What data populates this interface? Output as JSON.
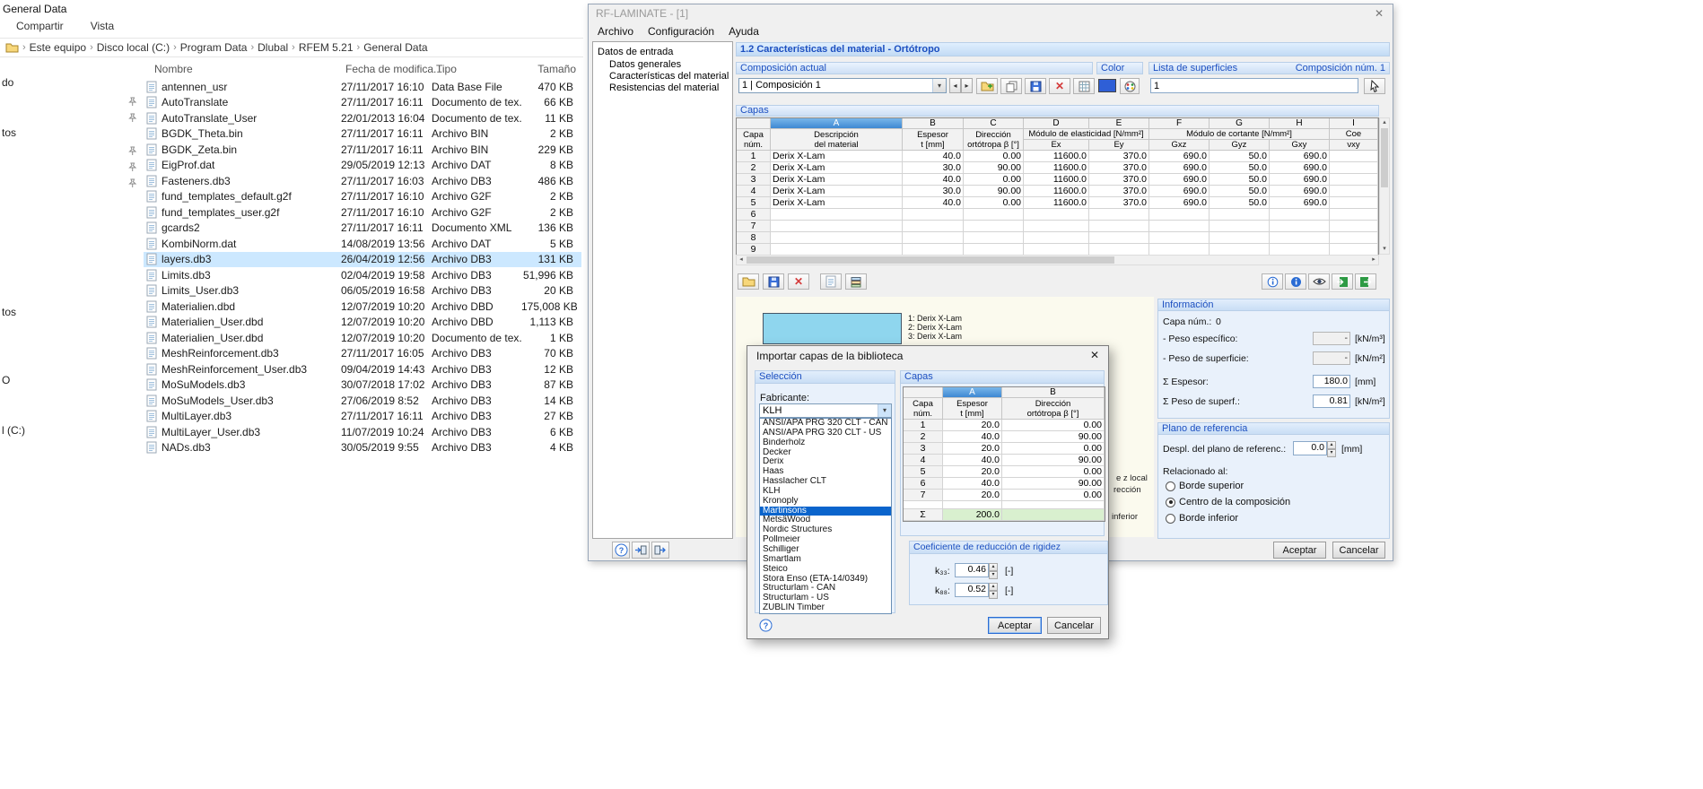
{
  "icons": {
    "close": "✕",
    "dropdown": "▾",
    "spin_up": "▴",
    "spin_down": "▾",
    "left": "◂",
    "right": "▸",
    "breadcrumb_sep": "›"
  },
  "colors": {
    "accent": "#0a64cc",
    "selection": "#cce8ff",
    "layer_cyan": "#8fd6ee",
    "swatch": "#2f5fd6",
    "sum_green": "#d9f0cf",
    "band_text": "#1c4fc0"
  },
  "explorer": {
    "window_title": "General Data",
    "menu_items": [
      "Compartir",
      "Vista"
    ],
    "breadcrumb_items": [
      "Este equipo",
      "Disco local (C:)",
      "Program Data",
      "Dlubal",
      "RFEM 5.21",
      "General Data"
    ],
    "columns": {
      "name": "Nombre",
      "date": "Fecha de modifica...",
      "type": "Tipo",
      "size": "Tamaño"
    },
    "sidebar_fragments": [
      "do",
      "tos",
      "tos",
      "O",
      "l (C:)"
    ],
    "files": [
      {
        "name": "antennen_usr",
        "date": "27/11/2017 16:10",
        "type": "Data Base File",
        "size": "470 KB",
        "selected": false
      },
      {
        "name": "AutoTranslate",
        "date": "27/11/2017 16:11",
        "type": "Documento de tex...",
        "size": "66 KB",
        "selected": false
      },
      {
        "name": "AutoTranslate_User",
        "date": "22/01/2013 16:04",
        "type": "Documento de tex...",
        "size": "11 KB",
        "selected": false
      },
      {
        "name": "BGDK_Theta.bin",
        "date": "27/11/2017 16:11",
        "type": "Archivo BIN",
        "size": "2 KB",
        "selected": false
      },
      {
        "name": "BGDK_Zeta.bin",
        "date": "27/11/2017 16:11",
        "type": "Archivo BIN",
        "size": "229 KB",
        "selected": false
      },
      {
        "name": "EigProf.dat",
        "date": "29/05/2019 12:13",
        "type": "Archivo DAT",
        "size": "8 KB",
        "selected": false
      },
      {
        "name": "Fasteners.db3",
        "date": "27/11/2017 16:03",
        "type": "Archivo DB3",
        "size": "486 KB",
        "selected": false
      },
      {
        "name": "fund_templates_default.g2f",
        "date": "27/11/2017 16:10",
        "type": "Archivo G2F",
        "size": "2 KB",
        "selected": false
      },
      {
        "name": "fund_templates_user.g2f",
        "date": "27/11/2017 16:10",
        "type": "Archivo G2F",
        "size": "2 KB",
        "selected": false
      },
      {
        "name": "gcards2",
        "date": "27/11/2017 16:11",
        "type": "Documento XML",
        "size": "136 KB",
        "selected": false
      },
      {
        "name": "KombiNorm.dat",
        "date": "14/08/2019 13:56",
        "type": "Archivo DAT",
        "size": "5 KB",
        "selected": false
      },
      {
        "name": "layers.db3",
        "date": "26/04/2019 12:56",
        "type": "Archivo DB3",
        "size": "131 KB",
        "selected": true
      },
      {
        "name": "Limits.db3",
        "date": "02/04/2019 19:58",
        "type": "Archivo DB3",
        "size": "51,996 KB",
        "selected": false
      },
      {
        "name": "Limits_User.db3",
        "date": "06/05/2019 16:58",
        "type": "Archivo DB3",
        "size": "20 KB",
        "selected": false
      },
      {
        "name": "Materialien.dbd",
        "date": "12/07/2019 10:20",
        "type": "Archivo DBD",
        "size": "175,008 KB",
        "selected": false
      },
      {
        "name": "Materialien_User.dbd",
        "date": "12/07/2019 10:20",
        "type": "Archivo DBD",
        "size": "1,113 KB",
        "selected": false
      },
      {
        "name": "Materialien_User.dbd",
        "date": "12/07/2019 10:20",
        "type": "Documento de tex...",
        "size": "1 KB",
        "selected": false
      },
      {
        "name": "MeshReinforcement.db3",
        "date": "27/11/2017 16:05",
        "type": "Archivo DB3",
        "size": "70 KB",
        "selected": false
      },
      {
        "name": "MeshReinforcement_User.db3",
        "date": "09/04/2019 14:43",
        "type": "Archivo DB3",
        "size": "12 KB",
        "selected": false
      },
      {
        "name": "MoSuModels.db3",
        "date": "30/07/2018 17:02",
        "type": "Archivo DB3",
        "size": "87 KB",
        "selected": false
      },
      {
        "name": "MoSuModels_User.db3",
        "date": "27/06/2019 8:52",
        "type": "Archivo DB3",
        "size": "14 KB",
        "selected": false
      },
      {
        "name": "MultiLayer.db3",
        "date": "27/11/2017 16:11",
        "type": "Archivo DB3",
        "size": "27 KB",
        "selected": false
      },
      {
        "name": "MultiLayer_User.db3",
        "date": "11/07/2019 10:24",
        "type": "Archivo DB3",
        "size": "6 KB",
        "selected": false
      },
      {
        "name": "NADs.db3",
        "date": "30/05/2019 9:55",
        "type": "Archivo DB3",
        "size": "4 KB",
        "selected": false
      }
    ]
  },
  "rf": {
    "title": "RF-LAMINATE - [1]",
    "menus": [
      "Archivo",
      "Configuración",
      "Ayuda"
    ],
    "nav": {
      "root": "Datos de entrada",
      "items": [
        "Datos generales",
        "Características del material",
        "Resistencias del material"
      ]
    },
    "header": "1.2 Características del material - Ortótropo",
    "composicion": {
      "label": "Composición actual",
      "value": "1 | Composición 1"
    },
    "color_label": "Color",
    "superficies": {
      "label": "Lista de superficies",
      "value": "1",
      "comp_num": "Composición núm. 1"
    },
    "capas_label": "Capas",
    "toolbar_icons": {
      "composition": [
        "new",
        "copy",
        "save",
        "delete",
        "table"
      ],
      "table_left": [
        "open",
        "save",
        "delete",
        "preview",
        "layers"
      ],
      "table_right": [
        "info",
        "info-filled",
        "eye",
        "excel-import",
        "excel-export"
      ],
      "bottom": [
        "help",
        "transfer-in",
        "transfer-out"
      ]
    },
    "table": {
      "letters": [
        "A",
        "B",
        "C",
        "D",
        "E",
        "F",
        "G",
        "H",
        "I"
      ],
      "capa_line1": "Capa",
      "capa_line2": "núm.",
      "desc1": "Descripción",
      "desc2": "del material",
      "esp1": "Espesor",
      "esp2": "t [mm]",
      "dir1": "Dirección",
      "dir2": "ortótropa β [°]",
      "elast": "Módulo de elasticidad [N/mm²]",
      "cort": "Módulo de cortante [N/mm²]",
      "coe": "Coe",
      "ex": "Ex",
      "ey": "Ey",
      "gxz": "Gxz",
      "gyz": "Gyz",
      "gxy": "Gxy",
      "vxy": "νxy",
      "rows": [
        {
          "num": "1",
          "mat": "Derix X-Lam",
          "t": "40.0",
          "dir": "0.00",
          "ex": "11600.0",
          "ey": "370.0",
          "gxz": "690.0",
          "gyz": "50.0",
          "gxy": "690.0"
        },
        {
          "num": "2",
          "mat": "Derix X-Lam",
          "t": "30.0",
          "dir": "90.00",
          "ex": "11600.0",
          "ey": "370.0",
          "gxz": "690.0",
          "gyz": "50.0",
          "gxy": "690.0"
        },
        {
          "num": "3",
          "mat": "Derix X-Lam",
          "t": "40.0",
          "dir": "0.00",
          "ex": "11600.0",
          "ey": "370.0",
          "gxz": "690.0",
          "gyz": "50.0",
          "gxy": "690.0"
        },
        {
          "num": "4",
          "mat": "Derix X-Lam",
          "t": "30.0",
          "dir": "90.00",
          "ex": "11600.0",
          "ey": "370.0",
          "gxz": "690.0",
          "gyz": "50.0",
          "gxy": "690.0"
        },
        {
          "num": "5",
          "mat": "Derix X-Lam",
          "t": "40.0",
          "dir": "0.00",
          "ex": "11600.0",
          "ey": "370.0",
          "gxz": "690.0",
          "gyz": "50.0",
          "gxy": "690.0"
        },
        {
          "num": "6"
        },
        {
          "num": "7"
        },
        {
          "num": "8"
        },
        {
          "num": "9"
        }
      ]
    },
    "graphic": {
      "layer_labels": [
        "1: Derix X-Lam",
        "2: Derix X-Lam",
        "3: Derix X-Lam"
      ],
      "fragments": [
        "e z local",
        "rección",
        "inferior"
      ]
    },
    "info": {
      "label": "Información",
      "capa_num_label": "Capa núm.:",
      "capa_num_value": "0",
      "rows": [
        {
          "label": "- Peso específico:",
          "value": "-",
          "unit": "[kN/m³]",
          "disabled": true
        },
        {
          "label": "- Peso de superficie:",
          "value": "-",
          "unit": "[kN/m²]",
          "disabled": true
        },
        {
          "label": "Σ Espesor:",
          "value": "180.0",
          "unit": "[mm]",
          "disabled": false
        },
        {
          "label": "Σ Peso de superf.:",
          "value": "0.81",
          "unit": "[kN/m²]",
          "disabled": false
        }
      ]
    },
    "plano": {
      "label": "Plano de referencia",
      "despl_label": "Despl. del plano de referenc.:",
      "despl_value": "0.0",
      "despl_unit": "[mm]",
      "relacionado": "Relacionado al:",
      "options": [
        {
          "label": "Borde superior",
          "checked": false
        },
        {
          "label": "Centro de la composición",
          "checked": true
        },
        {
          "label": "Borde inferior",
          "checked": false
        }
      ]
    },
    "buttons": {
      "ok": "Aceptar",
      "cancel": "Cancelar"
    }
  },
  "modal": {
    "title": "Importar capas de la biblioteca",
    "seleccion": {
      "label": "Selección",
      "fabricante": "Fabricante:",
      "combo_value": "KLH",
      "highlighted": "Martinsons",
      "options": [
        "ANSI/APA PRG 320 CLT - CAN",
        "ANSI/APA PRG 320 CLT - US",
        "Binderholz",
        "Decker",
        "Derix",
        "Haas",
        "Hasslacher CLT",
        "KLH",
        "Kronoply",
        "Martinsons",
        "MetsäWood",
        "Nordic Structures",
        "Pollmeier",
        "Schilliger",
        "Smartlam",
        "Steico",
        "Stora Enso (ETA-14/0349)",
        "Structurlam - CAN",
        "Structurlam - US",
        "ZÜBLIN Timber"
      ]
    },
    "capas": {
      "label": "Capas",
      "letters": [
        "A",
        "B"
      ],
      "capa_line1": "Capa",
      "capa_line2": "núm.",
      "colA1": "Espesor",
      "colA2": "t [mm]",
      "colB1": "Dirección",
      "colB2": "ortótropa β [°]",
      "rows": [
        {
          "num": "1",
          "t": "20.0",
          "dir": "0.00"
        },
        {
          "num": "2",
          "t": "40.0",
          "dir": "90.00"
        },
        {
          "num": "3",
          "t": "20.0",
          "dir": "0.00"
        },
        {
          "num": "4",
          "t": "40.0",
          "dir": "90.00"
        },
        {
          "num": "5",
          "t": "20.0",
          "dir": "0.00"
        },
        {
          "num": "6",
          "t": "40.0",
          "dir": "90.00"
        },
        {
          "num": "7",
          "t": "20.0",
          "dir": "0.00"
        }
      ],
      "sum_symbol": "Σ",
      "sum_value": "200.0"
    },
    "coef": {
      "label": "Coeficiente de reducción de rigidez",
      "k33_label": "k₃₃:",
      "k33_value": "0.46",
      "k88_label": "k₈₈:",
      "k88_value": "0.52",
      "unit": "[-]"
    },
    "buttons": {
      "ok": "Aceptar",
      "cancel": "Cancelar"
    }
  }
}
